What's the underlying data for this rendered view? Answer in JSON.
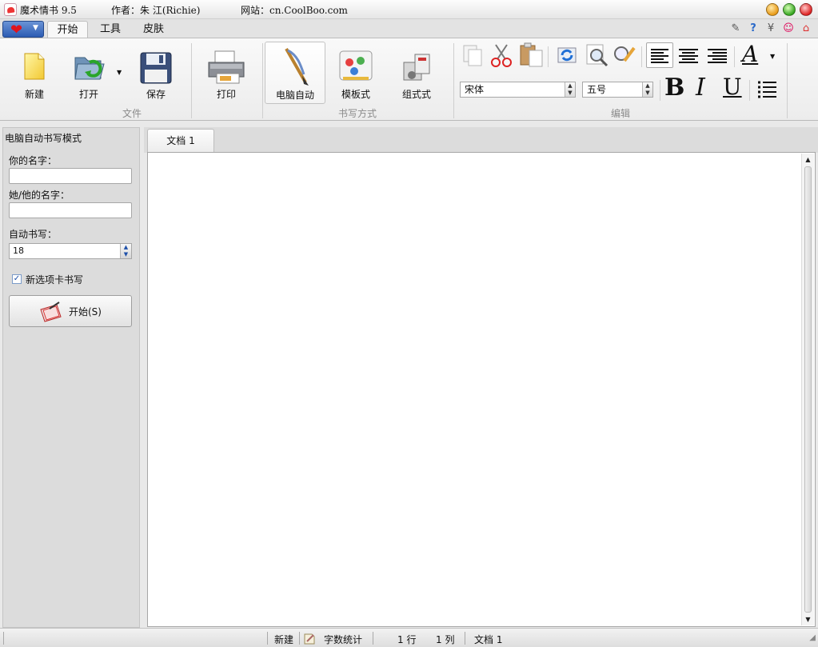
{
  "titlebar": {
    "app_name": "魔术情书 9.5",
    "author": "作者：朱 江(Richie)",
    "website": "网站：cn.CoolBoo.com"
  },
  "ribbon_tabs": [
    {
      "label": "开始",
      "active": true
    },
    {
      "label": "工具",
      "active": false
    },
    {
      "label": "皮肤",
      "active": false
    }
  ],
  "groups": {
    "file": {
      "label": "文件",
      "new": "新建",
      "open": "打开",
      "save": "保存",
      "print": "打印"
    },
    "writing_mode": {
      "label": "书写方式",
      "computer_auto": "电脑自动",
      "template": "模板式",
      "combination": "组式式"
    },
    "edit": {
      "label": "编辑",
      "font_name": "宋体",
      "font_size": "五号",
      "bold": "B",
      "italic": "I",
      "underline": "U"
    }
  },
  "panel": {
    "title": "电脑自动书写模式",
    "your_name_label": "你的名字：",
    "your_name_value": "",
    "their_name_label": "她/他的名字：",
    "their_name_value": "",
    "auto_write_label": "自动书写：",
    "auto_write_value": "18",
    "new_tab_checkbox_label": "新选项卡书写",
    "new_tab_checked": true,
    "start_button": "开始(S)"
  },
  "document": {
    "tab_label": "文档 1",
    "content": ""
  },
  "statusbar": {
    "new": "新建",
    "word_count": "字数统计",
    "line": "1 行",
    "column": "1 列",
    "doc_name": "文档 1"
  },
  "colors": {
    "accent_heart": "#e0151d",
    "app_menu_blue": "#2c5cb3"
  }
}
